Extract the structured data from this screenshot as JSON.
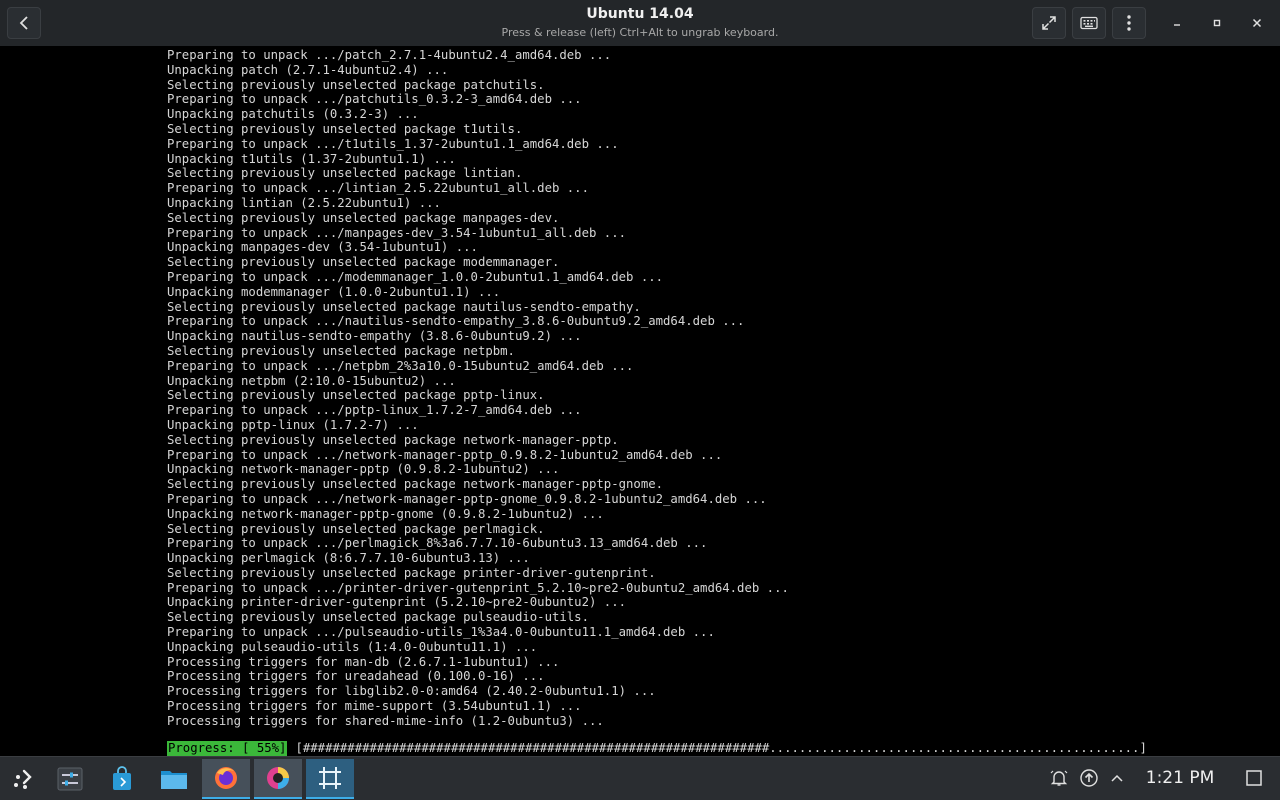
{
  "window": {
    "title": "Ubuntu 14.04",
    "subtitle": "Press & release (left) Ctrl+Alt to ungrab keyboard."
  },
  "terminal": {
    "lines": [
      "Preparing to unpack .../patch_2.7.1-4ubuntu2.4_amd64.deb ...",
      "Unpacking patch (2.7.1-4ubuntu2.4) ...",
      "Selecting previously unselected package patchutils.",
      "Preparing to unpack .../patchutils_0.3.2-3_amd64.deb ...",
      "Unpacking patchutils (0.3.2-3) ...",
      "Selecting previously unselected package t1utils.",
      "Preparing to unpack .../t1utils_1.37-2ubuntu1.1_amd64.deb ...",
      "Unpacking t1utils (1.37-2ubuntu1.1) ...",
      "Selecting previously unselected package lintian.",
      "Preparing to unpack .../lintian_2.5.22ubuntu1_all.deb ...",
      "Unpacking lintian (2.5.22ubuntu1) ...",
      "Selecting previously unselected package manpages-dev.",
      "Preparing to unpack .../manpages-dev_3.54-1ubuntu1_all.deb ...",
      "Unpacking manpages-dev (3.54-1ubuntu1) ...",
      "Selecting previously unselected package modemmanager.",
      "Preparing to unpack .../modemmanager_1.0.0-2ubuntu1.1_amd64.deb ...",
      "Unpacking modemmanager (1.0.0-2ubuntu1.1) ...",
      "Selecting previously unselected package nautilus-sendto-empathy.",
      "Preparing to unpack .../nautilus-sendto-empathy_3.8.6-0ubuntu9.2_amd64.deb ...",
      "Unpacking nautilus-sendto-empathy (3.8.6-0ubuntu9.2) ...",
      "Selecting previously unselected package netpbm.",
      "Preparing to unpack .../netpbm_2%3a10.0-15ubuntu2_amd64.deb ...",
      "Unpacking netpbm (2:10.0-15ubuntu2) ...",
      "Selecting previously unselected package pptp-linux.",
      "Preparing to unpack .../pptp-linux_1.7.2-7_amd64.deb ...",
      "Unpacking pptp-linux (1.7.2-7) ...",
      "Selecting previously unselected package network-manager-pptp.",
      "Preparing to unpack .../network-manager-pptp_0.9.8.2-1ubuntu2_amd64.deb ...",
      "Unpacking network-manager-pptp (0.9.8.2-1ubuntu2) ...",
      "Selecting previously unselected package network-manager-pptp-gnome.",
      "Preparing to unpack .../network-manager-pptp-gnome_0.9.8.2-1ubuntu2_amd64.deb ...",
      "Unpacking network-manager-pptp-gnome (0.9.8.2-1ubuntu2) ...",
      "Selecting previously unselected package perlmagick.",
      "Preparing to unpack .../perlmagick_8%3a6.7.7.10-6ubuntu3.13_amd64.deb ...",
      "Unpacking perlmagick (8:6.7.7.10-6ubuntu3.13) ...",
      "Selecting previously unselected package printer-driver-gutenprint.",
      "Preparing to unpack .../printer-driver-gutenprint_5.2.10~pre2-0ubuntu2_amd64.deb ...",
      "Unpacking printer-driver-gutenprint (5.2.10~pre2-0ubuntu2) ...",
      "Selecting previously unselected package pulseaudio-utils.",
      "Preparing to unpack .../pulseaudio-utils_1%3a4.0-0ubuntu11.1_amd64.deb ...",
      "Unpacking pulseaudio-utils (1:4.0-0ubuntu11.1) ...",
      "Processing triggers for man-db (2.6.7.1-1ubuntu1) ...",
      "Processing triggers for ureadahead (0.100.0-16) ...",
      "Processing triggers for libglib2.0-0:amd64 (2.40.2-0ubuntu1.1) ...",
      "Processing triggers for mime-support (3.54ubuntu1.1) ...",
      "Processing triggers for shared-mime-info (1.2-0ubuntu3) ..."
    ],
    "progress_label": "Progress: [ 55%]",
    "progress_bar": "[###############################################################..................................................]",
    "progress_percent": 55
  },
  "taskbar": {
    "clock": "1:21 PM",
    "items": [
      "application-launcher-icon",
      "settings-icon",
      "software-store-icon",
      "file-manager-icon",
      "firefox-icon",
      "color-app-icon",
      "virtual-machine-icon"
    ]
  },
  "colors": {
    "titlebar_bg": "#232629",
    "terminal_bg": "#000000",
    "terminal_fg": "#d6d6d6",
    "progress_green": "#3bb83a",
    "taskbar_bg": "#2a2d31",
    "accent": "#3daee9"
  }
}
